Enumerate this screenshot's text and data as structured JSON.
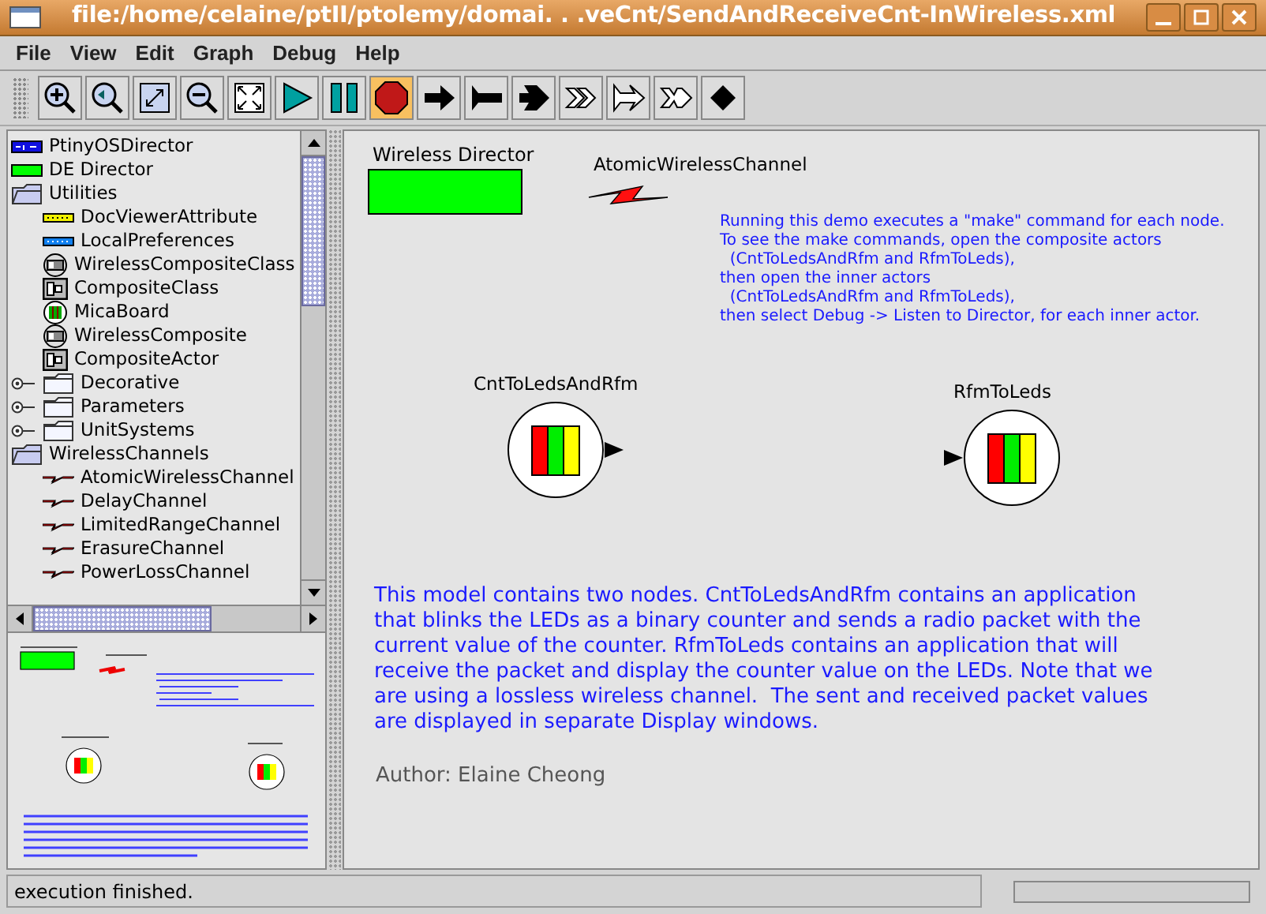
{
  "window": {
    "title": "file:/home/celaine/ptII/ptolemy/domai. . .veCnt/SendAndReceiveCnt-InWireless.xml"
  },
  "menu": [
    "File",
    "View",
    "Edit",
    "Graph",
    "Debug",
    "Help"
  ],
  "toolbar": [
    {
      "kind": "zoom-in",
      "active": false
    },
    {
      "kind": "zoom-reset",
      "active": false
    },
    {
      "kind": "zoom-fit",
      "active": false
    },
    {
      "kind": "zoom-out",
      "active": false
    },
    {
      "kind": "full-screen",
      "active": false
    },
    {
      "kind": "run",
      "active": false
    },
    {
      "kind": "pause",
      "active": false
    },
    {
      "kind": "stop",
      "active": true
    },
    {
      "kind": "arrow",
      "active": false
    },
    {
      "kind": "flag",
      "active": false
    },
    {
      "kind": "notched-arrow",
      "active": false
    },
    {
      "kind": "double-arrow",
      "active": false
    },
    {
      "kind": "outline-flag",
      "active": false
    },
    {
      "kind": "outline-notched",
      "active": false
    },
    {
      "kind": "diamond",
      "active": false
    }
  ],
  "library_tree": [
    {
      "label": "PtinyOSDirector",
      "kind": "ptiny-director"
    },
    {
      "label": "DE Director",
      "kind": "de-director"
    },
    {
      "label": "Utilities",
      "kind": "folder",
      "expanded": true,
      "children": [
        {
          "label": "DocViewerAttribute",
          "kind": "doc-attribute"
        },
        {
          "label": "LocalPreferences",
          "kind": "preferences"
        },
        {
          "label": "WirelessCompositeClass",
          "kind": "wireless-composite"
        },
        {
          "label": "CompositeClass",
          "kind": "composite"
        },
        {
          "label": "MicaBoard",
          "kind": "mica-board"
        },
        {
          "label": "WirelessComposite",
          "kind": "wireless-composite"
        },
        {
          "label": "CompositeActor",
          "kind": "composite"
        }
      ]
    },
    {
      "label": "Decorative",
      "kind": "folder",
      "expanded": false
    },
    {
      "label": "Parameters",
      "kind": "folder",
      "expanded": false
    },
    {
      "label": "UnitSystems",
      "kind": "folder",
      "expanded": false
    },
    {
      "label": "WirelessChannels",
      "kind": "folder",
      "expanded": true,
      "children": [
        {
          "label": "AtomicWirelessChannel",
          "kind": "channel"
        },
        {
          "label": "DelayChannel",
          "kind": "channel"
        },
        {
          "label": "LimitedRangeChannel",
          "kind": "channel"
        },
        {
          "label": "ErasureChannel",
          "kind": "channel"
        },
        {
          "label": "PowerLossChannel",
          "kind": "channel"
        }
      ]
    }
  ],
  "canvas": {
    "director": {
      "label": "Wireless Director",
      "color": "#00ff00"
    },
    "channel": {
      "label": "AtomicWirelessChannel"
    },
    "instructions": "Running this demo executes a \"make\" command for each node.\nTo see the make commands, open the composite actors\n  (CntToLedsAndRfm and RfmToLeds),\nthen open the inner actors\n  (CntToLedsAndRfm and RfmToLeds),\nthen select Debug -> Listen to Director, for each inner actor.",
    "nodes": [
      {
        "label": "CntToLedsAndRfm",
        "kind": "sender"
      },
      {
        "label": "RfmToLeds",
        "kind": "receiver"
      }
    ],
    "description": "This model contains two nodes. CntToLedsAndRfm contains an application\nthat blinks the LEDs as a binary counter and sends a radio packet with the\ncurrent value of the counter. RfmToLeds contains an application that will\nreceive the packet and display the counter value on the LEDs. Note that we\nare using a lossless wireless channel.  The sent and received packet values\nare displayed in separate Display windows.",
    "author": "Author: Elaine Cheong"
  },
  "status_bar": {
    "message": "execution finished.",
    "progress": {
      "level": 0
    }
  }
}
